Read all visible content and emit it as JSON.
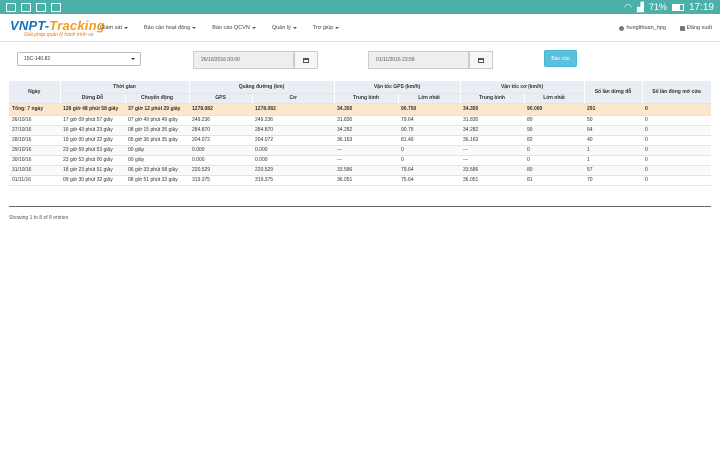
{
  "statusbar": {
    "battery": "71%",
    "time": "17:19"
  },
  "app": {
    "logo_main": "VNPT-",
    "logo_accent": "Tracking",
    "logo_slogan": "Giải pháp quản lý hành trình xe"
  },
  "menu": [
    {
      "label": "Giám sát"
    },
    {
      "label": "Báo cáo hoạt động"
    },
    {
      "label": "Báo cáo QCVN"
    },
    {
      "label": "Quản lý"
    },
    {
      "label": "Trợ giúp"
    }
  ],
  "user": {
    "name": "hunglthuan_hpg",
    "logout": "Đăng xuất"
  },
  "filters": {
    "vehicle": "15C-140.82",
    "from": "26/10/2016 00:00",
    "to": "01/11/2016 23:59",
    "report_button": "Báo cáo"
  },
  "table": {
    "head": {
      "date": "Ngày",
      "time_group": "Thời gian",
      "distance_group": "Quãng đường (km)",
      "gps_speed_group": "Vận tốc GPS (km/h)",
      "mech_speed_group": "Vận tốc cơ (km/h)",
      "stops": "Số lần dừng đỗ",
      "door": "Số lần đóng mở cửa",
      "stopped": "Dừng Đỗ",
      "moving": "Chuyển động",
      "gps": "GPS",
      "mech": "Cơ",
      "avg1": "Trung bình",
      "max1": "Lớn nhất",
      "avg2": "Trung bình",
      "max2": "Lớn nhất"
    },
    "total": [
      "Tổng: 7 ngày",
      "128 giờ 48 phút 58 giây",
      "37 giờ 12 phút 29 giây",
      "1278.082",
      "1278.082",
      "34.350",
      "90.750",
      "34.350",
      "90.000",
      "291",
      "0"
    ],
    "rows": [
      [
        "26/10/16",
        "17 giờ 09 phút 57 giây",
        "07 giờ 49 phút 49 giây",
        "249.236",
        "249.236",
        "31.830",
        "79.64",
        "31.830",
        "80",
        "50",
        "0"
      ],
      [
        "27/10/16",
        "16 giờ 43 phút 23 giây",
        "08 giờ 15 phút 35 giây",
        "284.870",
        "284.870",
        "34.282",
        "90.75",
        "34.282",
        "90",
        "64",
        "0"
      ],
      [
        "28/10/16",
        "19 giờ 00 phút 22 giây",
        "05 giờ 36 phút 35 giây",
        "204.072",
        "204.072",
        "36.163",
        "81.49",
        "36.163",
        "82",
        "40",
        "0"
      ],
      [
        "29/10/16",
        "23 giờ 59 phút 53 giây",
        "00 giây",
        "0.000",
        "0.000",
        "---",
        "0",
        "---",
        "0",
        "1",
        "0"
      ],
      [
        "30/10/16",
        "23 giờ 53 phút 00 giây",
        "00 giây",
        "0.000",
        "0.000",
        "---",
        "0",
        "---",
        "0",
        "1",
        "0"
      ],
      [
        "31/10/16",
        "18 giờ 23 phút 51 giây",
        "06 giờ 33 phút 58 giây",
        "220.529",
        "220.529",
        "33.586",
        "79.64",
        "33.586",
        "80",
        "57",
        "0"
      ],
      [
        "01/11/16",
        "09 giờ 30 phút 32 giây",
        "08 giờ 51 phút 32 giây",
        "319.375",
        "319.375",
        "36.051",
        "75.64",
        "36.051",
        "81",
        "70",
        "0"
      ]
    ],
    "footer": "Showing 1 to 8 of 8 entries"
  }
}
